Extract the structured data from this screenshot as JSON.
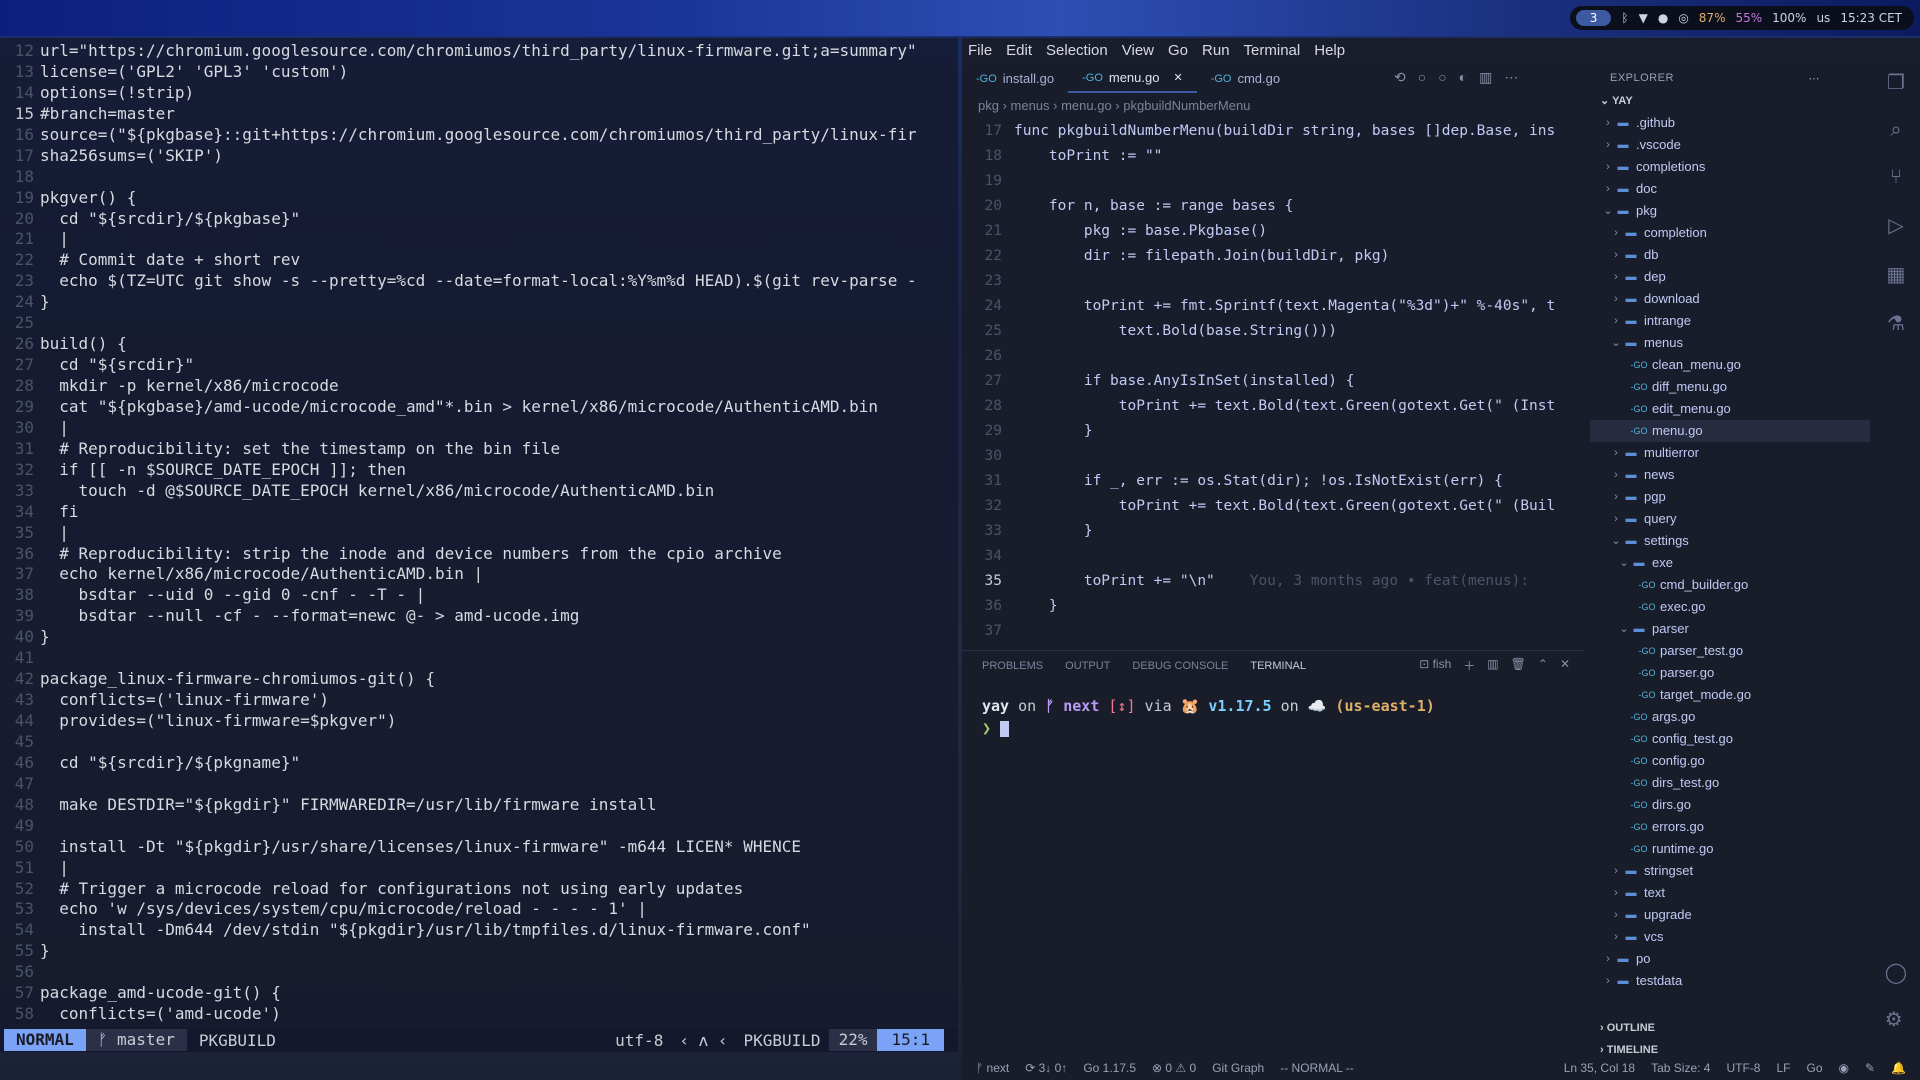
{
  "topbar": {
    "workspace": "3",
    "battery": "87%",
    "memory": "55%",
    "volume": "100%",
    "layout": "us",
    "time": "15:23 CET"
  },
  "vim": {
    "lines": [
      {
        "n": "12",
        "t": "url=\"https://chromium.googlesource.com/chromiumos/third_party/linux-firmware.git;a=summary\""
      },
      {
        "n": "13",
        "t": "license=('GPL2' 'GPL3' 'custom')"
      },
      {
        "n": "14",
        "t": "options=(!strip)"
      },
      {
        "n": "15",
        "t": "#branch=master",
        "cur": true,
        "cmt": true
      },
      {
        "n": "16",
        "t": "source=(\"${pkgbase}::git+https://chromium.googlesource.com/chromiumos/third_party/linux-fir"
      },
      {
        "n": "17",
        "t": "sha256sums=('SKIP')"
      },
      {
        "n": "18",
        "t": ""
      },
      {
        "n": "19",
        "t": "pkgver() {"
      },
      {
        "n": "20",
        "t": "  cd \"${srcdir}/${pkgbase}\""
      },
      {
        "n": "21",
        "t": "  |"
      },
      {
        "n": "22",
        "t": "  # Commit date + short rev",
        "cmt": true
      },
      {
        "n": "23",
        "t": "  echo $(TZ=UTC git show -s --pretty=%cd --date=format-local:%Y%m%d HEAD).$(git rev-parse -"
      },
      {
        "n": "24",
        "t": "}"
      },
      {
        "n": "25",
        "t": ""
      },
      {
        "n": "26",
        "t": "build() {"
      },
      {
        "n": "27",
        "t": "  cd \"${srcdir}\""
      },
      {
        "n": "28",
        "t": "  mkdir -p kernel/x86/microcode"
      },
      {
        "n": "29",
        "t": "  cat \"${pkgbase}/amd-ucode/microcode_amd\"*.bin > kernel/x86/microcode/AuthenticAMD.bin"
      },
      {
        "n": "30",
        "t": "  |"
      },
      {
        "n": "31",
        "t": "  # Reproducibility: set the timestamp on the bin file",
        "cmt": true
      },
      {
        "n": "32",
        "t": "  if [[ -n $SOURCE_DATE_EPOCH ]]; then"
      },
      {
        "n": "33",
        "t": "    touch -d @$SOURCE_DATE_EPOCH kernel/x86/microcode/AuthenticAMD.bin"
      },
      {
        "n": "34",
        "t": "  fi"
      },
      {
        "n": "35",
        "t": "  |"
      },
      {
        "n": "36",
        "t": "  # Reproducibility: strip the inode and device numbers from the cpio archive",
        "cmt": true
      },
      {
        "n": "37",
        "t": "  echo kernel/x86/microcode/AuthenticAMD.bin |"
      },
      {
        "n": "38",
        "t": "    bsdtar --uid 0 --gid 0 -cnf - -T - |"
      },
      {
        "n": "39",
        "t": "    bsdtar --null -cf - --format=newc @- > amd-ucode.img"
      },
      {
        "n": "40",
        "t": "}"
      },
      {
        "n": "41",
        "t": ""
      },
      {
        "n": "42",
        "t": "package_linux-firmware-chromiumos-git() {"
      },
      {
        "n": "43",
        "t": "  conflicts=('linux-firmware')"
      },
      {
        "n": "44",
        "t": "  provides=(\"linux-firmware=$pkgver\")"
      },
      {
        "n": "45",
        "t": ""
      },
      {
        "n": "46",
        "t": "  cd \"${srcdir}/${pkgname}\""
      },
      {
        "n": "47",
        "t": ""
      },
      {
        "n": "48",
        "t": "  make DESTDIR=\"${pkgdir}\" FIRMWAREDIR=/usr/lib/firmware install"
      },
      {
        "n": "49",
        "t": ""
      },
      {
        "n": "50",
        "t": "  install -Dt \"${pkgdir}/usr/share/licenses/linux-firmware\" -m644 LICEN* WHENCE"
      },
      {
        "n": "51",
        "t": "  |"
      },
      {
        "n": "52",
        "t": "  # Trigger a microcode reload for configurations not using early updates",
        "cmt": true
      },
      {
        "n": "53",
        "t": "  echo 'w /sys/devices/system/cpu/microcode/reload - - - - 1' |"
      },
      {
        "n": "54",
        "t": "    install -Dm644 /dev/stdin \"${pkgdir}/usr/lib/tmpfiles.d/linux-firmware.conf\""
      },
      {
        "n": "55",
        "t": "}"
      },
      {
        "n": "56",
        "t": ""
      },
      {
        "n": "57",
        "t": "package_amd-ucode-git() {"
      },
      {
        "n": "58",
        "t": "  conflicts=('amd-ucode')"
      }
    ],
    "status": {
      "mode": "NORMAL",
      "branch": "master",
      "file": "PKGBUILD",
      "encoding": "utf-8",
      "filetype": "PKGBUILD",
      "percent": "22%",
      "position": "15:1"
    }
  },
  "vscode": {
    "menu": [
      "File",
      "Edit",
      "Selection",
      "View",
      "Go",
      "Run",
      "Terminal",
      "Help"
    ],
    "tabs": [
      {
        "label": "install.go",
        "active": false
      },
      {
        "label": "menu.go",
        "active": true
      },
      {
        "label": "cmd.go",
        "active": false
      }
    ],
    "breadcrumb": "pkg  ›  menus  ›  menu.go  ›  pkgbuildNumberMenu",
    "code": [
      {
        "n": "17",
        "t": "func pkgbuildNumberMenu(buildDir string, bases []dep.Base, ins"
      },
      {
        "n": "18",
        "t": "    toPrint := \"\""
      },
      {
        "n": "19",
        "t": ""
      },
      {
        "n": "20",
        "t": "    for n, base := range bases {"
      },
      {
        "n": "21",
        "t": "        pkg := base.Pkgbase()"
      },
      {
        "n": "22",
        "t": "        dir := filepath.Join(buildDir, pkg)"
      },
      {
        "n": "23",
        "t": ""
      },
      {
        "n": "24",
        "t": "        toPrint += fmt.Sprintf(text.Magenta(\"%3d\")+\" %-40s\", t"
      },
      {
        "n": "25",
        "t": "            text.Bold(base.String()))"
      },
      {
        "n": "26",
        "t": ""
      },
      {
        "n": "27",
        "t": "        if base.AnyIsInSet(installed) {"
      },
      {
        "n": "28",
        "t": "            toPrint += text.Bold(text.Green(gotext.Get(\" (Inst"
      },
      {
        "n": "29",
        "t": "        }"
      },
      {
        "n": "30",
        "t": ""
      },
      {
        "n": "31",
        "t": "        if _, err := os.Stat(dir); !os.IsNotExist(err) {"
      },
      {
        "n": "32",
        "t": "            toPrint += text.Bold(text.Green(gotext.Get(\" (Buil"
      },
      {
        "n": "33",
        "t": "        }"
      },
      {
        "n": "34",
        "t": ""
      },
      {
        "n": "35",
        "t": "        toPrint += \"\\n\"",
        "ghost": "    You, 3 months ago • feat(menus):",
        "cur": true
      },
      {
        "n": "36",
        "t": "    }"
      },
      {
        "n": "37",
        "t": ""
      }
    ],
    "panel_tabs": [
      "PROBLEMS",
      "OUTPUT",
      "DEBUG CONSOLE",
      "TERMINAL"
    ],
    "terminal": {
      "shell": "fish",
      "dir": "yay",
      "on1": " on ",
      "branch": "ᚠ next",
      "mark": " [↕]",
      "via": " via ",
      "version": "🐹 v1.17.5",
      "on2": " on ",
      "aws": "☁️ (us-east-1)",
      "prompt": "❯"
    },
    "explorer": {
      "title": "EXPLORER",
      "root": "YAY",
      "items": [
        {
          "label": ".github",
          "d": 1,
          "type": "folder",
          "open": false
        },
        {
          "label": ".vscode",
          "d": 1,
          "type": "folder",
          "open": false
        },
        {
          "label": "completions",
          "d": 1,
          "type": "folder",
          "open": false
        },
        {
          "label": "doc",
          "d": 1,
          "type": "folder",
          "open": false
        },
        {
          "label": "pkg",
          "d": 1,
          "type": "folder",
          "open": true
        },
        {
          "label": "completion",
          "d": 2,
          "type": "folder",
          "open": false
        },
        {
          "label": "db",
          "d": 2,
          "type": "folder",
          "open": false
        },
        {
          "label": "dep",
          "d": 2,
          "type": "folder",
          "open": false
        },
        {
          "label": "download",
          "d": 2,
          "type": "folder",
          "open": false
        },
        {
          "label": "intrange",
          "d": 2,
          "type": "folder",
          "open": false
        },
        {
          "label": "menus",
          "d": 2,
          "type": "folder",
          "open": true
        },
        {
          "label": "clean_menu.go",
          "d": 3,
          "type": "file"
        },
        {
          "label": "diff_menu.go",
          "d": 3,
          "type": "file"
        },
        {
          "label": "edit_menu.go",
          "d": 3,
          "type": "file"
        },
        {
          "label": "menu.go",
          "d": 3,
          "type": "file",
          "sel": true
        },
        {
          "label": "multierror",
          "d": 2,
          "type": "folder",
          "open": false
        },
        {
          "label": "news",
          "d": 2,
          "type": "folder",
          "open": false
        },
        {
          "label": "pgp",
          "d": 2,
          "type": "folder",
          "open": false
        },
        {
          "label": "query",
          "d": 2,
          "type": "folder",
          "open": false
        },
        {
          "label": "settings",
          "d": 2,
          "type": "folder",
          "open": true
        },
        {
          "label": "exe",
          "d": 3,
          "type": "folder",
          "open": true
        },
        {
          "label": "cmd_builder.go",
          "d": 4,
          "type": "file"
        },
        {
          "label": "exec.go",
          "d": 4,
          "type": "file"
        },
        {
          "label": "parser",
          "d": 3,
          "type": "folder",
          "open": true
        },
        {
          "label": "parser_test.go",
          "d": 4,
          "type": "file"
        },
        {
          "label": "parser.go",
          "d": 4,
          "type": "file"
        },
        {
          "label": "target_mode.go",
          "d": 4,
          "type": "file"
        },
        {
          "label": "args.go",
          "d": 3,
          "type": "file"
        },
        {
          "label": "config_test.go",
          "d": 3,
          "type": "file"
        },
        {
          "label": "config.go",
          "d": 3,
          "type": "file"
        },
        {
          "label": "dirs_test.go",
          "d": 3,
          "type": "file"
        },
        {
          "label": "dirs.go",
          "d": 3,
          "type": "file"
        },
        {
          "label": "errors.go",
          "d": 3,
          "type": "file"
        },
        {
          "label": "runtime.go",
          "d": 3,
          "type": "file"
        },
        {
          "label": "stringset",
          "d": 2,
          "type": "folder",
          "open": false
        },
        {
          "label": "text",
          "d": 2,
          "type": "folder",
          "open": false
        },
        {
          "label": "upgrade",
          "d": 2,
          "type": "folder",
          "open": false
        },
        {
          "label": "vcs",
          "d": 2,
          "type": "folder",
          "open": false
        },
        {
          "label": "po",
          "d": 1,
          "type": "folder",
          "open": false
        },
        {
          "label": "testdata",
          "d": 1,
          "type": "folder",
          "open": false
        }
      ],
      "outline": "OUTLINE",
      "timeline": "TIMELINE"
    },
    "status": {
      "branch": "next",
      "sync": "3↓ 0↑",
      "go": "Go 1.17.5",
      "problems": "0 ⚠ 0",
      "gitgraph": "Git Graph",
      "vimmode": "-- NORMAL --",
      "cursor": "Ln 35, Col 18",
      "tabsize": "Tab Size: 4",
      "encoding": "UTF-8",
      "eol": "LF",
      "lang": "Go"
    }
  }
}
